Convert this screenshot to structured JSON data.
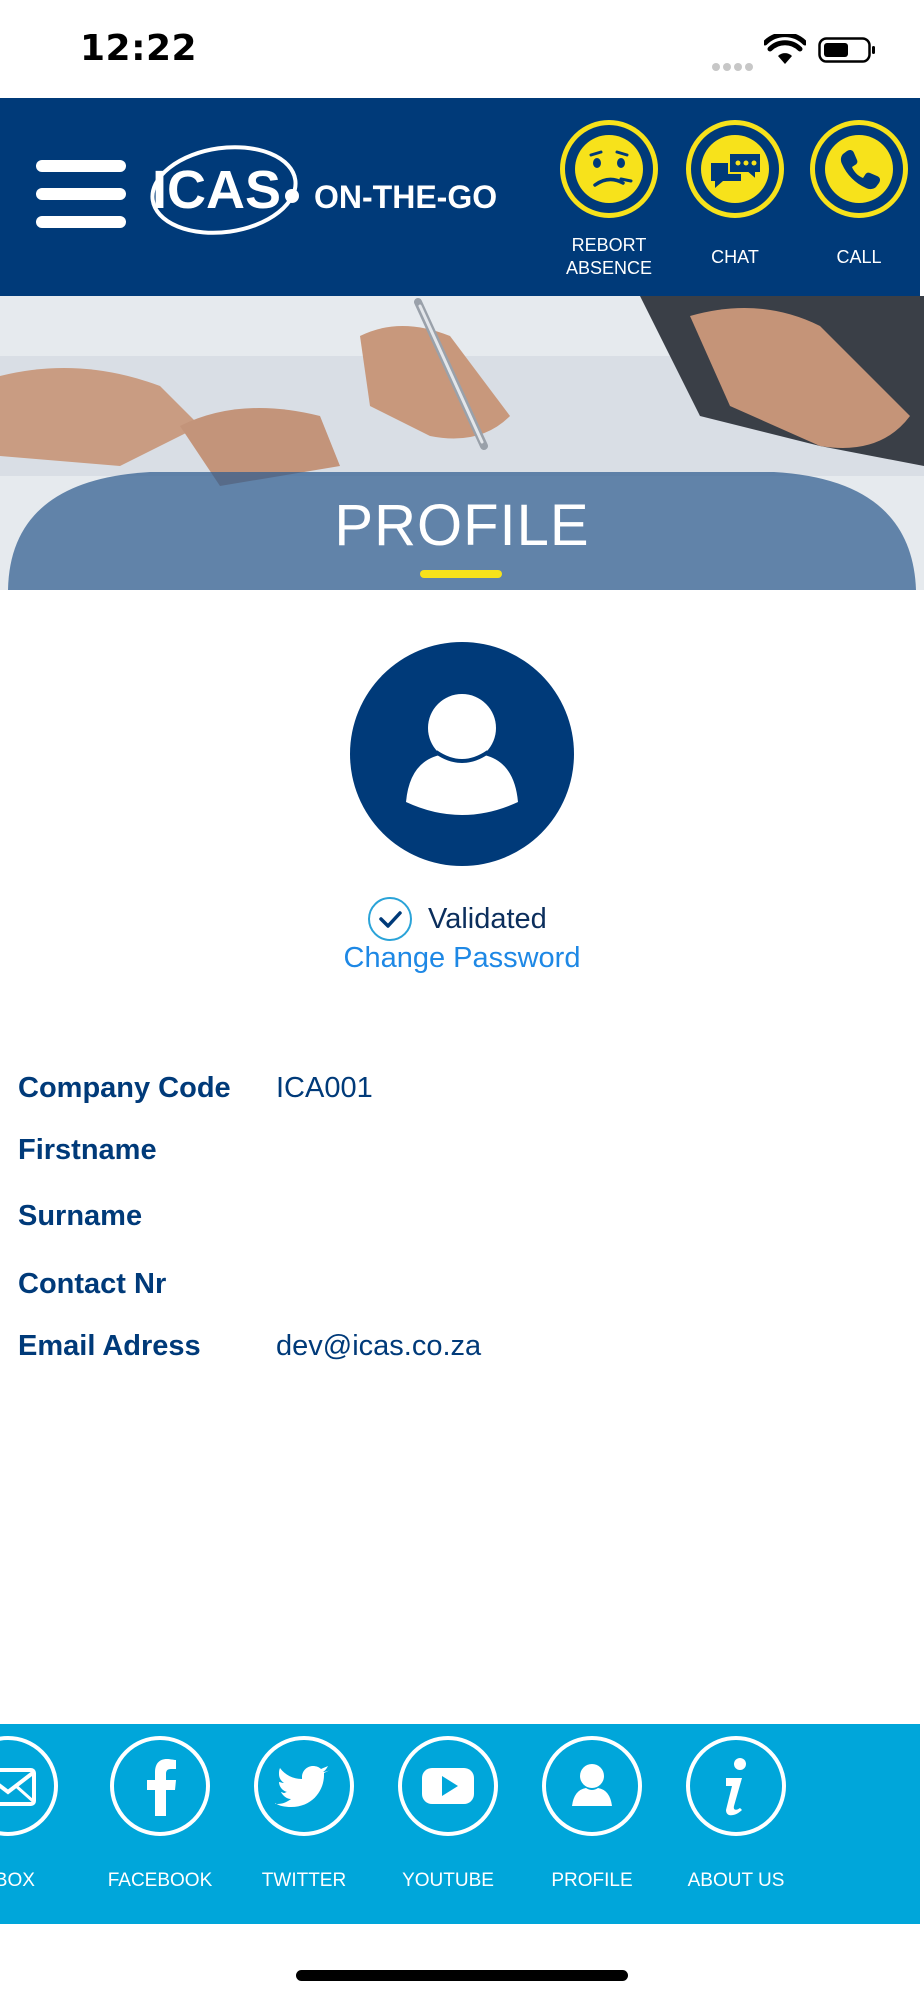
{
  "status_bar": {
    "time": "12:22"
  },
  "header": {
    "logo_text": "ICAS",
    "logo_tagline": "ON-THE-GO",
    "actions": [
      {
        "label": "REBORT\nABSENCE",
        "label_line1": "REBORT",
        "label_line2": "ABSENCE",
        "icon": "sad-face-icon"
      },
      {
        "label": "CHAT",
        "icon": "chat-bubbles-icon"
      },
      {
        "label": "CALL",
        "icon": "phone-icon"
      }
    ]
  },
  "banner": {
    "title": "PROFILE"
  },
  "profile": {
    "status": "Validated",
    "change_password": "Change Password",
    "fields": [
      {
        "label": "Company Code",
        "value": "ICA001"
      },
      {
        "label": "Firstname",
        "value": ""
      },
      {
        "label": "Surname",
        "value": ""
      },
      {
        "label": "Contact Nr",
        "value": ""
      },
      {
        "label": "Email Adress",
        "value": "dev@icas.co.za"
      }
    ]
  },
  "bottom_nav": {
    "items": [
      {
        "label": "NBOX",
        "icon": "envelope-icon"
      },
      {
        "label": "FACEBOOK",
        "icon": "facebook-icon"
      },
      {
        "label": "TWITTER",
        "icon": "twitter-icon"
      },
      {
        "label": "YOUTUBE",
        "icon": "youtube-icon"
      },
      {
        "label": "PROFILE",
        "icon": "user-icon"
      },
      {
        "label": "ABOUT US",
        "icon": "info-icon"
      }
    ]
  },
  "colors": {
    "brand_navy": "#003a79",
    "accent_yellow": "#f7e21b",
    "nav_blue": "#00a6da",
    "link_blue": "#1e88e5"
  }
}
